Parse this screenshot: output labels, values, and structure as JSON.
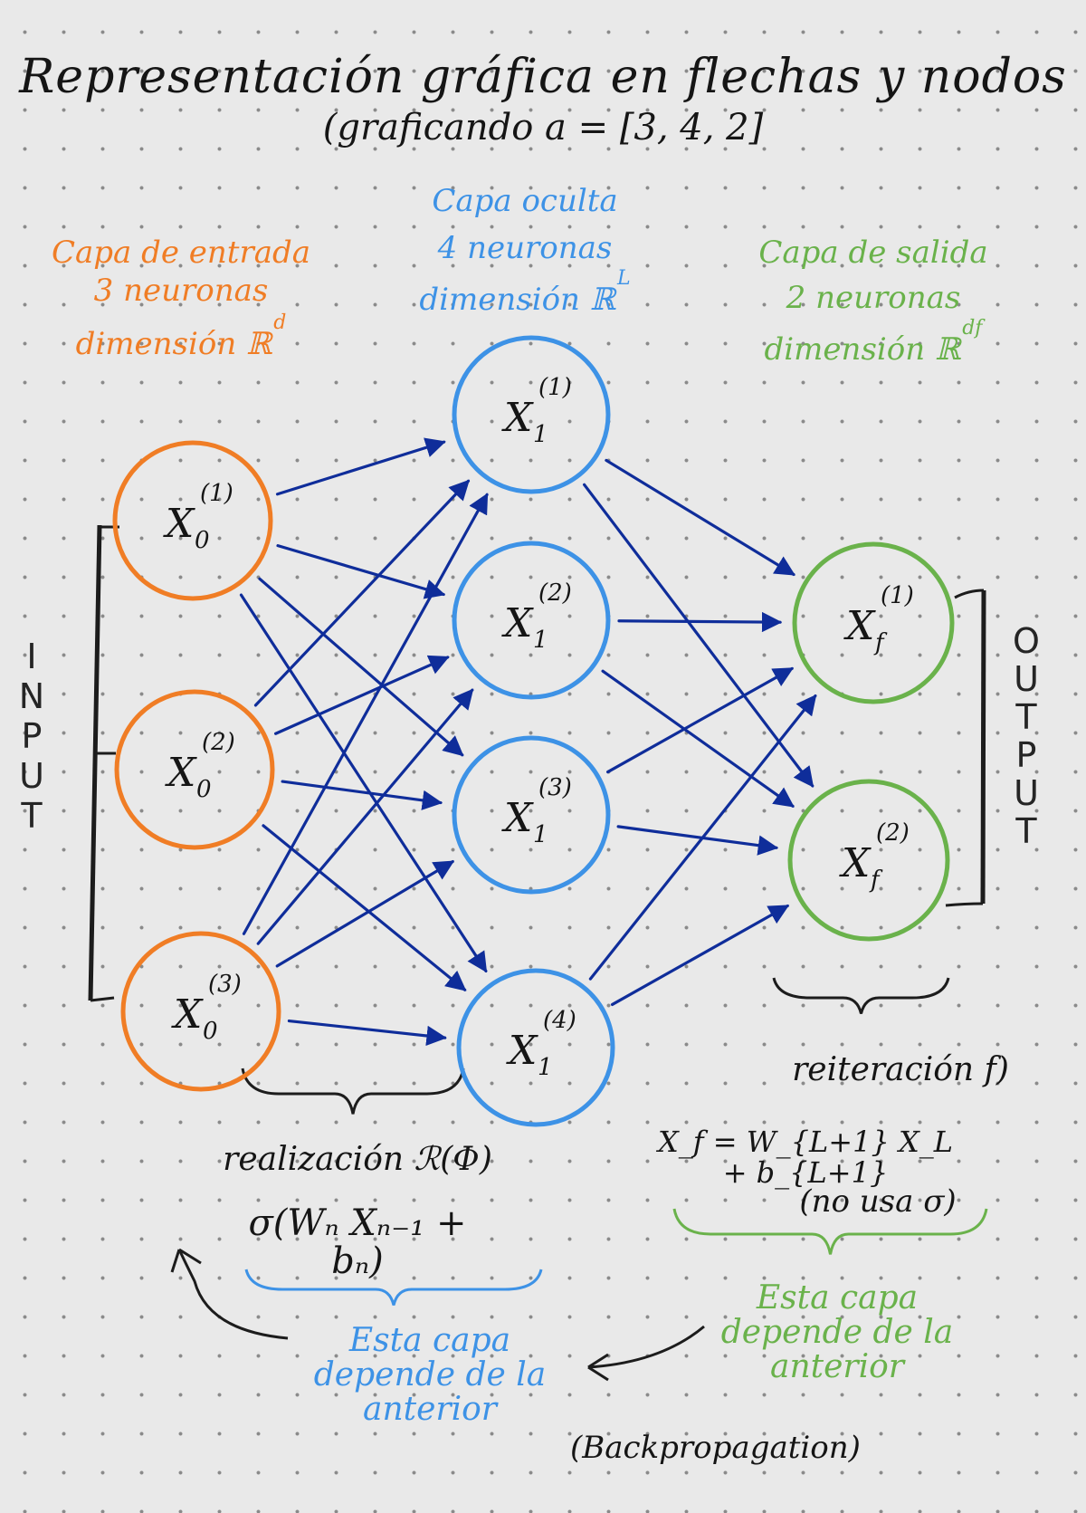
{
  "title": "Representación gráfica en flechas y nodos",
  "subtitle": "(graficando a = [3, 4, 2]",
  "layers": {
    "input": {
      "title": "Capa de entrada",
      "count": "3 neuronas",
      "dimension": "dimensión ℝ",
      "dim_sup": "d",
      "color": "#f07d25",
      "side_label": "INPUT",
      "nodes": [
        {
          "name": "X",
          "sub": "0",
          "sup": "(1)"
        },
        {
          "name": "X",
          "sub": "0",
          "sup": "(2)"
        },
        {
          "name": "X",
          "sub": "0",
          "sup": "(3)"
        }
      ]
    },
    "hidden": {
      "title": "Capa oculta",
      "count": "4 neuronas",
      "dimension": "dimensión ℝ",
      "dim_sup": "L",
      "color": "#3d92e6",
      "nodes": [
        {
          "name": "X",
          "sub": "1",
          "sup": "(1)"
        },
        {
          "name": "X",
          "sub": "1",
          "sup": "(2)"
        },
        {
          "name": "X",
          "sub": "1",
          "sup": "(3)"
        },
        {
          "name": "X",
          "sub": "1",
          "sup": "(4)"
        }
      ]
    },
    "output": {
      "title": "Capa de salida",
      "count": "2 neuronas",
      "dimension": "dimensión ℝ",
      "dim_sup": "df",
      "color": "#6ab24b",
      "side_label": "OUTPUT",
      "nodes": [
        {
          "name": "X",
          "sub": "f",
          "sup": "(1)"
        },
        {
          "name": "X",
          "sub": "f",
          "sup": "(2)"
        }
      ]
    }
  },
  "arrow_color": "#0f2d9a",
  "annotations": {
    "realization": "realización ℛ(Φ)",
    "hidden_formula": "σ(Wₙ Xₙ₋₁ + bₙ)",
    "iteration": "reiteración f)",
    "output_formula": "X_f = W_{L+1} X_L + b_{L+1}",
    "no_sigma": "(no usa σ)",
    "depends_blue": "Esta capa depende de la anterior",
    "depends_green": "Esta capa depende de la anterior",
    "backprop": "(Backpropagation)"
  }
}
